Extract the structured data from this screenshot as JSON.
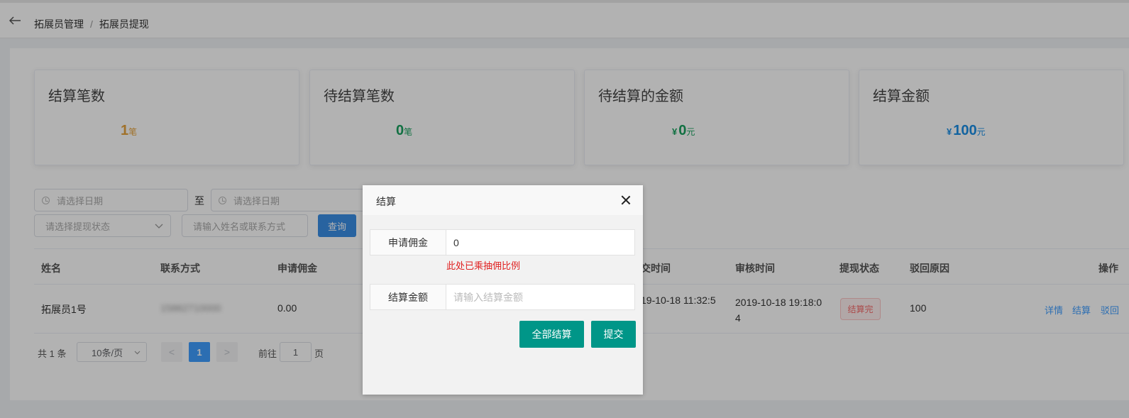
{
  "breadcrumb": {
    "parent": "拓展员管理",
    "separator": "/",
    "current": "拓展员提现"
  },
  "stats": [
    {
      "title": "结算笔数",
      "currency": "",
      "value": "1",
      "unit": "笔",
      "color": "#e6a23c"
    },
    {
      "title": "待结算笔数",
      "currency": "",
      "value": "0",
      "unit": "笔",
      "color": "#19a15f"
    },
    {
      "title": "待结算的金额",
      "currency": "¥",
      "value": "0",
      "unit": "元",
      "color": "#19a15f"
    },
    {
      "title": "结算金额",
      "currency": "¥",
      "value": "100",
      "unit": "元",
      "color": "#1a8ee6"
    }
  ],
  "filters": {
    "start_date_placeholder": "请选择日期",
    "to_label": "至",
    "end_date_placeholder": "请选择日期",
    "status_placeholder": "请选择提现状态",
    "keyword_placeholder": "请输入姓名或联系方式",
    "query_label": "查询"
  },
  "table": {
    "headers": [
      "姓名",
      "联系方式",
      "申请佣金",
      "交时间",
      "审核时间",
      "提现状态",
      "驳回原因",
      "操作"
    ],
    "row": {
      "name": "拓展员1号",
      "contact": "15862710000",
      "commission": "0.00",
      "submit_time_line1": "19-10-18 11:32:5",
      "audit_time_line1": "2019-10-18 19:18:0",
      "audit_time_line2": "4",
      "status": "结算完",
      "reject_reason": "100",
      "actions": [
        "详情",
        "结算",
        "驳回"
      ]
    }
  },
  "pagination": {
    "total_text": "共 1 条",
    "page_size": "10条/页",
    "prev": "<",
    "current_page": "1",
    "next": ">",
    "goto_label": "前往",
    "goto_value": "1",
    "page_suffix": "页"
  },
  "dialog": {
    "title": "结算",
    "commission_label": "申请佣金",
    "commission_value": "0",
    "hint": "此处已乘抽佣比例",
    "amount_label": "结算金额",
    "amount_placeholder": "请输入结算金额",
    "settle_all_label": "全部结算",
    "submit_label": "提交"
  }
}
